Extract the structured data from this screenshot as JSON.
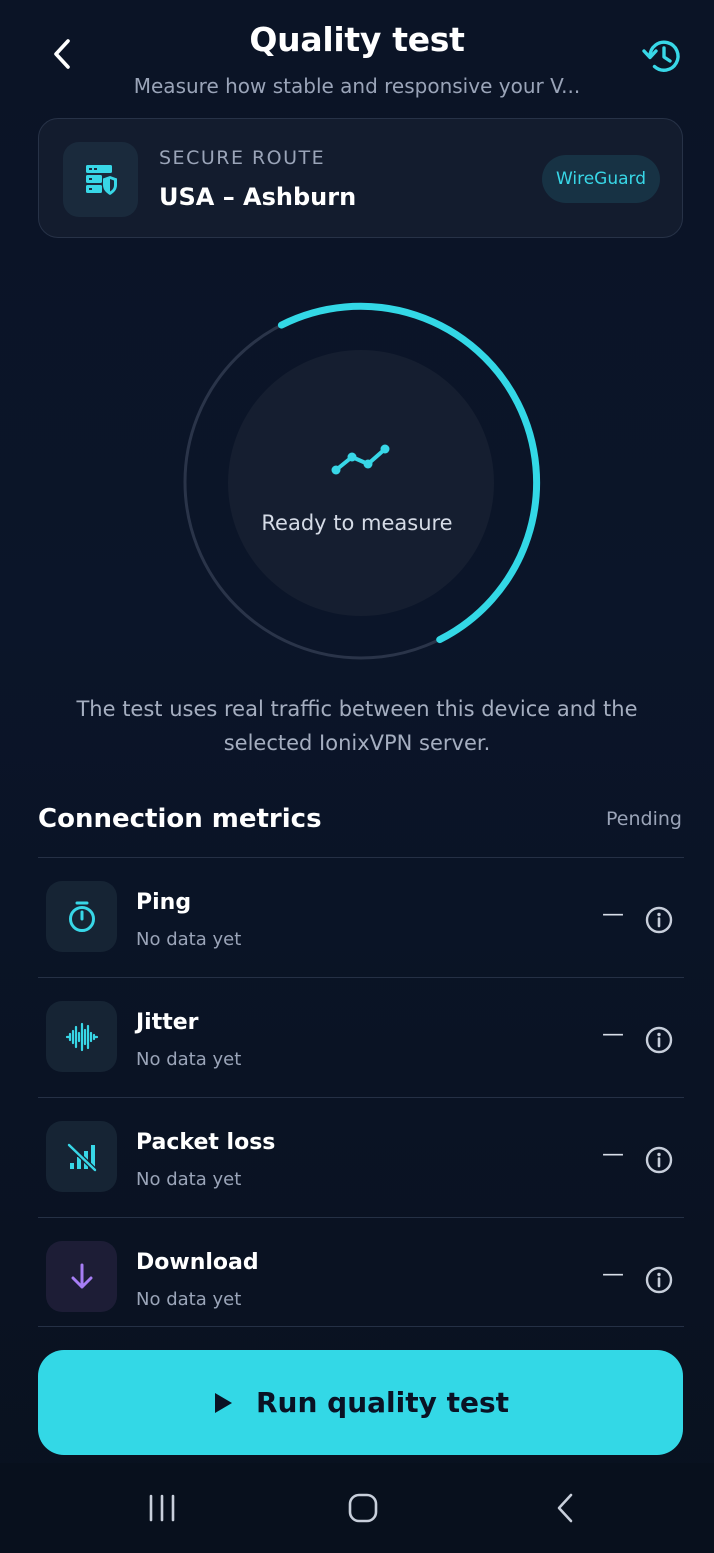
{
  "header": {
    "title": "Quality test",
    "subtitle": "Measure how stable and responsive your V..."
  },
  "route": {
    "kicker": "SECURE ROUTE",
    "name": "USA – Ashburn",
    "protocol": "WireGuard",
    "icon": "server-shield-icon"
  },
  "gauge": {
    "label": "Ready to measure",
    "icon": "trend-line-icon",
    "accent": "#38d7e7"
  },
  "explain": "The test uses real traffic between this device and the selected IonixVPN server.",
  "metrics": {
    "title": "Connection metrics",
    "status": "Pending",
    "items": [
      {
        "name": "Ping",
        "sub": "No data yet",
        "value": "—",
        "icon": "stopwatch-icon"
      },
      {
        "name": "Jitter",
        "sub": "No data yet",
        "value": "—",
        "icon": "waveform-icon"
      },
      {
        "name": "Packet loss",
        "sub": "No data yet",
        "value": "—",
        "icon": "signal-off-icon"
      },
      {
        "name": "Download",
        "sub": "No data yet",
        "value": "—",
        "icon": "download-arrow-icon"
      }
    ]
  },
  "action": {
    "label": "Run quality test"
  },
  "colors": {
    "accent": "#33d8e6",
    "background": "#0b1426",
    "card": "#131c2e",
    "download_accent": "#a77ef5"
  }
}
